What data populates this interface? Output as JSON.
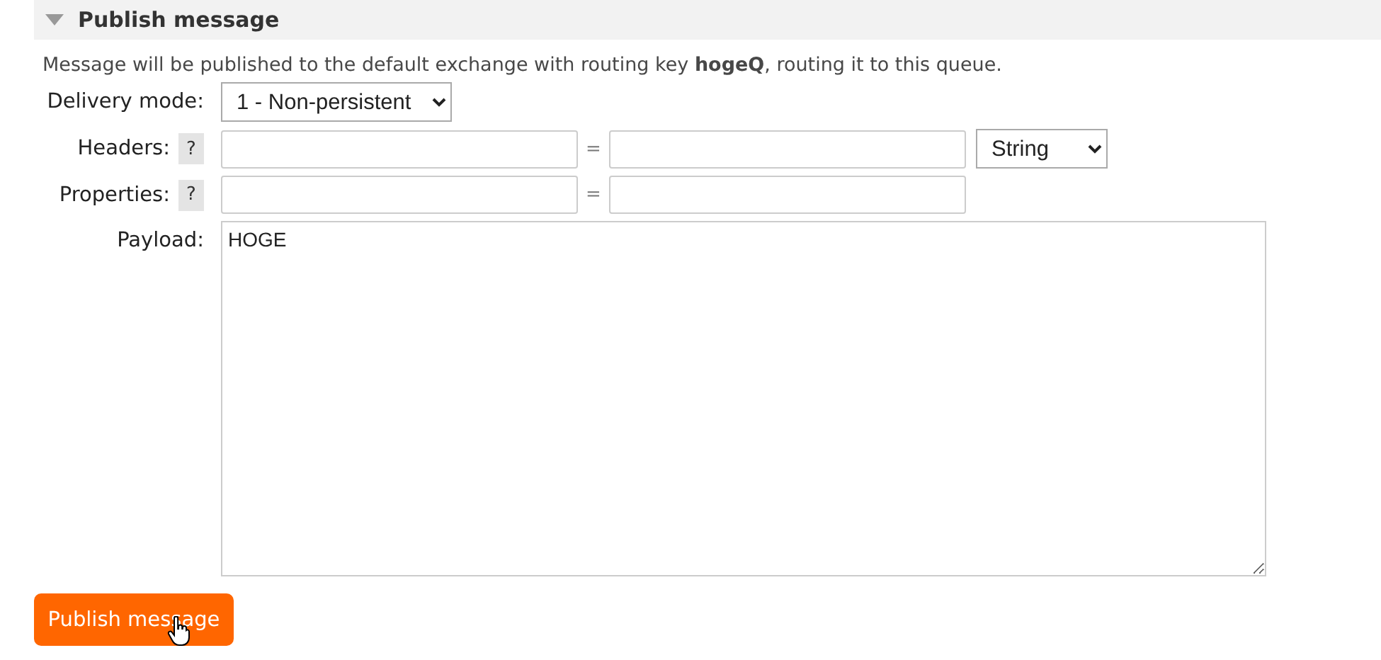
{
  "section": {
    "title": "Publish message",
    "expanded": true
  },
  "description": "Message will be published to the default exchange with routing key **hogeQ**, routing it to this queue.",
  "delivery_mode": {
    "label": "Delivery mode:",
    "value": "1 - Non-persistent"
  },
  "headers": {
    "label": "Headers:",
    "help": "?",
    "separator": "=",
    "type": "String"
  },
  "properties": {
    "label": "Properties:",
    "help": "?",
    "separator": "="
  },
  "payload": {
    "label": "Payload:",
    "value": "HOGE"
  },
  "button": "Publish message"
}
